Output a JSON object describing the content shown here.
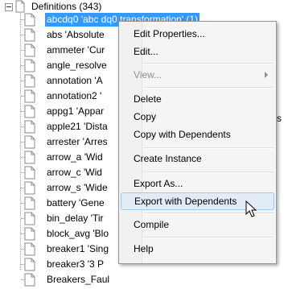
{
  "tree": {
    "root_label": "Definitions (343)",
    "selected_item": {
      "label": "abcdq0 'abc dq0 transformation' (1)"
    },
    "items": [
      "abs 'Absolute",
      "ammeter 'Cur",
      "angle_resolve",
      "annotation 'A",
      "annotation2 '",
      "appg1 'Appar",
      "apple21 'Dista",
      "arrester 'Arres",
      "arrow_a 'Wid",
      "arrow_c 'Wid",
      "arrow_s 'Wide",
      "battery 'Gene",
      "bin_delay 'Tir",
      "block_avg 'Blo",
      "breaker1 'Sing",
      "breaker3 '3 P",
      "Breakers_Faul"
    ],
    "side_text": "cs"
  },
  "context_menu": {
    "items": [
      {
        "label": "Edit Properties...",
        "enabled": true
      },
      {
        "label": "Edit...",
        "enabled": true
      },
      {
        "label": "View...",
        "enabled": false,
        "submenu": true
      },
      {
        "label": "Delete",
        "enabled": true
      },
      {
        "label": "Copy",
        "enabled": true
      },
      {
        "label": "Copy with Dependents",
        "enabled": true
      },
      {
        "label": "Create Instance",
        "enabled": true
      },
      {
        "label": "Export As...",
        "enabled": true
      },
      {
        "label": "Export with Dependents",
        "enabled": true,
        "hovered": true
      },
      {
        "label": "Compile",
        "enabled": true
      },
      {
        "label": "Help",
        "enabled": true
      }
    ]
  },
  "colors": {
    "selection": "#3399ff",
    "menu_background": "#f5f5f5",
    "menu_hover": "#e2ecf7",
    "disabled_text": "#8d8d8d"
  }
}
